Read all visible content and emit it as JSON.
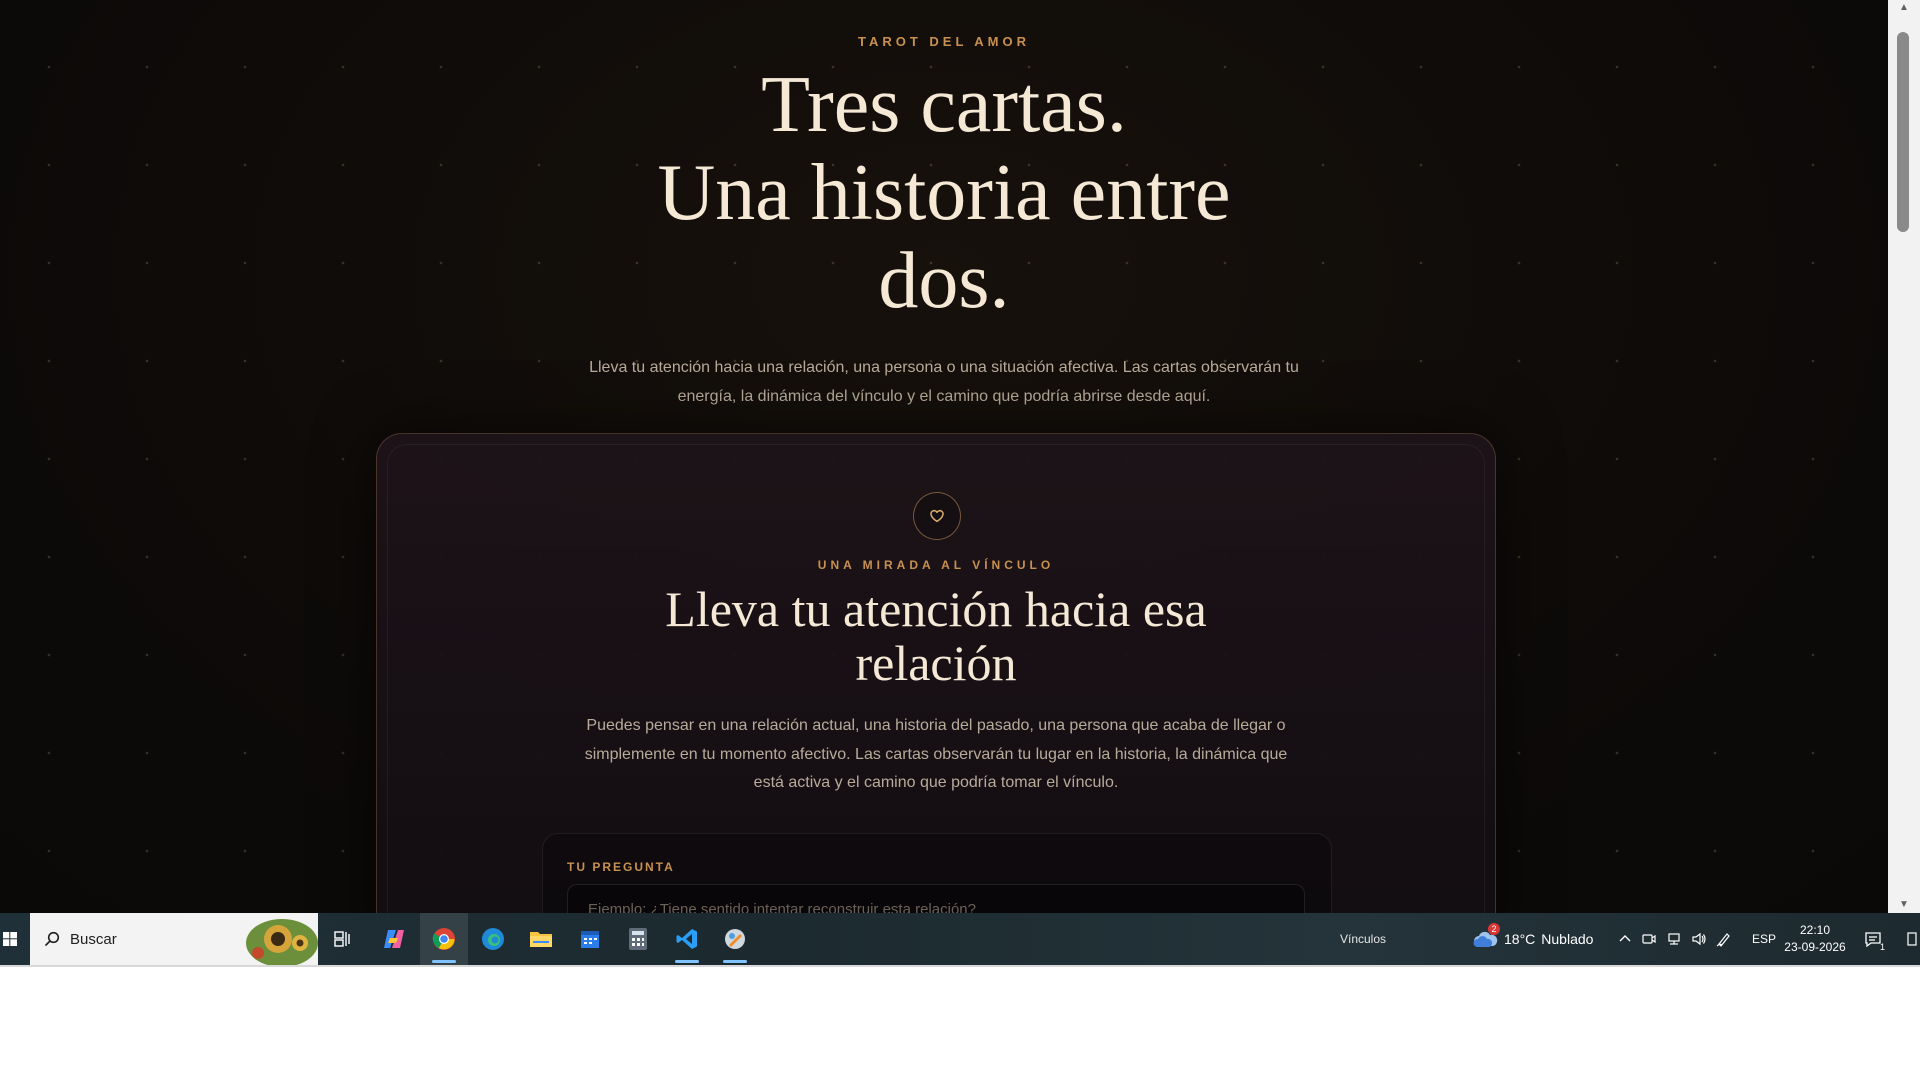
{
  "hero": {
    "eyebrow": "TAROT DEL AMOR",
    "title_line1": "Tres cartas.",
    "title_line2": "Una historia entre dos.",
    "intro": "Lleva tu atención hacia una relación, una persona o una situación afectiva. Las cartas observarán tu energía, la dinámica del vínculo y el camino que podría abrirse desde aquí."
  },
  "card": {
    "icon": "heart-icon",
    "eyebrow": "UNA MIRADA AL VÍNCULO",
    "title": "Lleva tu atención hacia esa relación",
    "description": "Puedes pensar en una relación actual, una historia del pasado, una persona que acaba de llegar o simplemente en tu momento afectivo. Las cartas observarán tu lugar en la historia, la dinámica que está activa y el camino que podría tomar el vínculo.",
    "question": {
      "label": "TU PREGUNTA",
      "placeholder": "Ejemplo: ¿Tiene sentido intentar reconstruir esta relación?"
    }
  },
  "taskbar": {
    "search_label": "Buscar",
    "links_label": "Vínculos",
    "weather": {
      "temp": "18°C",
      "condition": "Nublado",
      "badge": "2"
    },
    "language": "ESP",
    "time": "22:10",
    "date": "23-09-2026",
    "notification_count": "1",
    "apps": [
      "task-view",
      "copilot",
      "chrome",
      "edge",
      "file-explorer",
      "calendar",
      "calculator",
      "vscode",
      "app-wrench"
    ]
  },
  "colors": {
    "accent": "#c8914f",
    "heading": "#f5e9d6",
    "body_text": "#b9ab9a",
    "background": "#0e0b09"
  }
}
